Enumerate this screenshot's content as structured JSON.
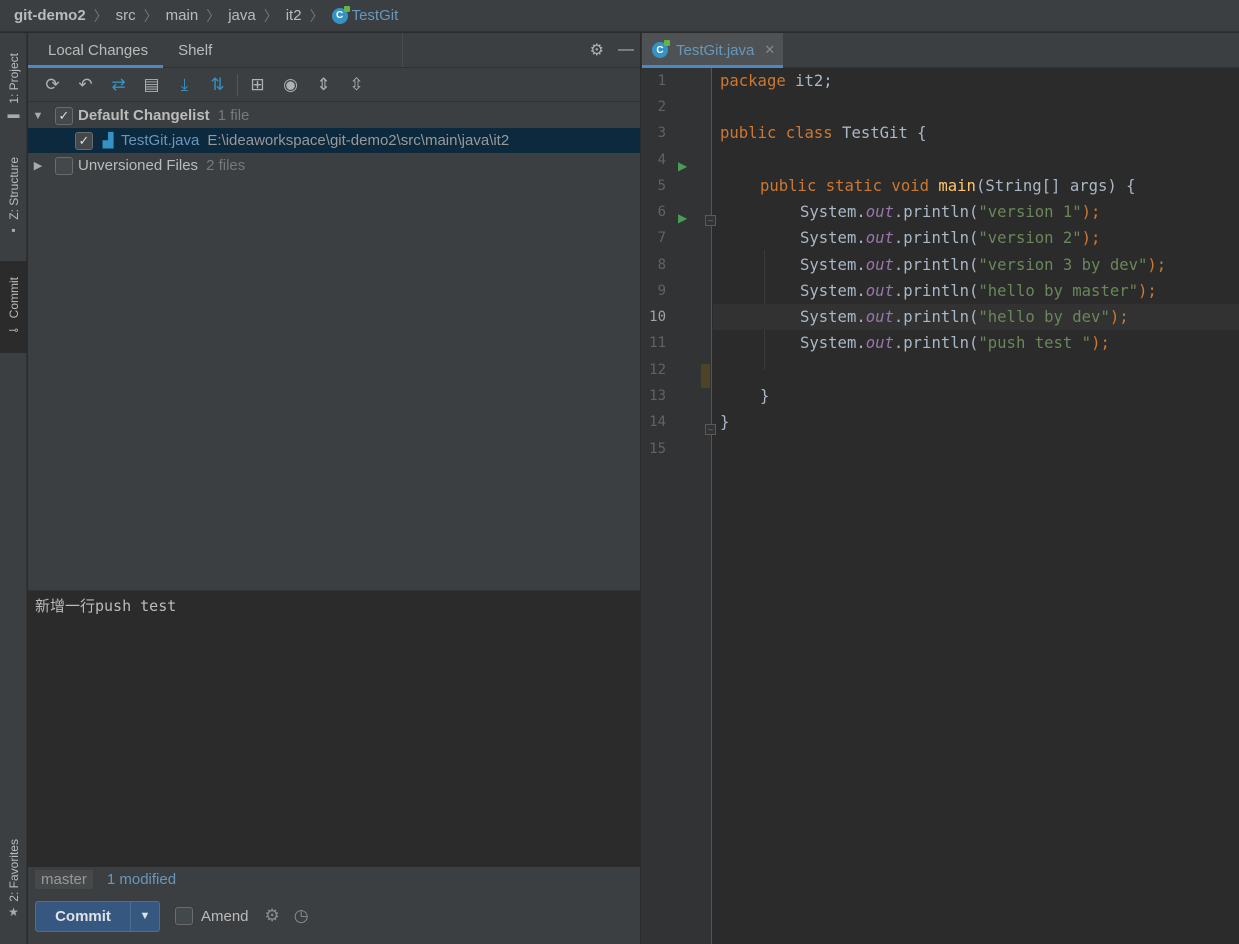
{
  "breadcrumb": {
    "items": [
      "git-demo2",
      "src",
      "main",
      "java",
      "it2",
      "TestGit"
    ]
  },
  "left_stripe": {
    "project": "1: Project",
    "structure": "Z: Structure",
    "commit": "Commit",
    "favorites": "2: Favorites"
  },
  "commit_panel": {
    "tabs": [
      "Local Changes",
      "Shelf"
    ],
    "changelist": {
      "name": "Default Changelist",
      "count": "1 file",
      "checked": true
    },
    "changed_file": {
      "name": "TestGit.java",
      "path": "E:\\ideaworkspace\\git-demo2\\src\\main\\java\\it2",
      "checked": true
    },
    "unversioned": {
      "name": "Unversioned Files",
      "count": "2 files",
      "checked": false
    },
    "message": "新增一行push test",
    "branch": "master",
    "modified": "1 modified",
    "commit_label": "Commit",
    "amend_label": "Amend",
    "amend_checked": false
  },
  "editor": {
    "tab_title": "TestGit.java",
    "current_line": 10,
    "line_numbers": [
      "1",
      "2",
      "3",
      "4",
      "5",
      "6",
      "7",
      "8",
      "9",
      "10",
      "11",
      "12",
      "13",
      "14",
      "15"
    ]
  },
  "code": {
    "l1_kw": "package",
    "l1_rest": " it2;",
    "l3_kw": "public class",
    "l3_rest": " TestGit {",
    "l5_kw1": "public static void",
    "l5_fn": "main",
    "l5_rest": "(String[] args) {",
    "sys": "System.",
    "out": "out",
    "println": ".println(",
    "end": ");",
    "s6": "\"version 1\"",
    "s7": "\"version 2\"",
    "s8": "\"version 3 by dev\"",
    "s9": "\"hello by master\"",
    "s10": "\"hello by dev\"",
    "s11": "\"push test \"",
    "l13": "}",
    "l14": "}"
  },
  "colors": {
    "accent": "#4a88c7",
    "keyword": "#cc7832",
    "string": "#6a8759",
    "function": "#ffc66d",
    "field": "#9876aa",
    "file_blue": "#6897bb"
  }
}
